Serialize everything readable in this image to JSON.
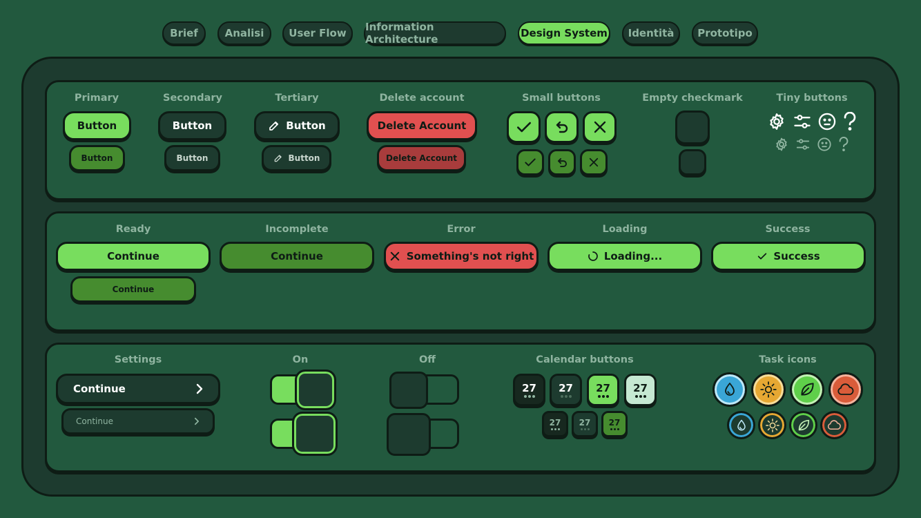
{
  "tabs": [
    {
      "label": "Brief",
      "active": false
    },
    {
      "label": "Analisi",
      "active": false
    },
    {
      "label": "User Flow",
      "active": false
    },
    {
      "label": "Information Architecture",
      "active": false
    },
    {
      "label": "Design System",
      "active": true
    },
    {
      "label": "Identità",
      "active": false
    },
    {
      "label": "Prototipo",
      "active": false
    }
  ],
  "buttons_panel": {
    "primary": {
      "label": "Primary",
      "large": "Button",
      "small": "Button"
    },
    "secondary": {
      "label": "Secondary",
      "large": "Button",
      "small": "Button"
    },
    "tertiary": {
      "label": "Tertiary",
      "large": "Button",
      "small": "Button",
      "icon": "pencil-icon"
    },
    "delete": {
      "label": "Delete account",
      "large": "Delete Account",
      "small": "Delete Account"
    },
    "small_buttons": {
      "label": "Small buttons",
      "icons": [
        "check-icon",
        "undo-icon",
        "close-icon"
      ]
    },
    "empty_checkmark": {
      "label": "Empty checkmark"
    },
    "tiny_buttons": {
      "label": "Tiny buttons",
      "icons": [
        "gear-icon",
        "sliders-icon",
        "face-icon",
        "question-icon"
      ]
    }
  },
  "states_panel": {
    "ready": {
      "label": "Ready",
      "large": "Continue",
      "small": "Continue"
    },
    "incomplete": {
      "label": "Incomplete",
      "large": "Continue"
    },
    "error": {
      "label": "Error",
      "large": "Something's not right",
      "icon": "close-icon"
    },
    "loading": {
      "label": "Loading",
      "large": "Loading...",
      "icon": "spinner-icon"
    },
    "success": {
      "label": "Success",
      "large": "Success",
      "icon": "check-icon"
    }
  },
  "misc_panel": {
    "settings": {
      "label": "Settings",
      "large": "Continue",
      "small": "Continue",
      "icon": "chevron-right-icon"
    },
    "on": {
      "label": "On"
    },
    "off": {
      "label": "Off"
    },
    "calendar": {
      "label": "Calendar buttons",
      "day": "27"
    },
    "task_icons": {
      "label": "Task icons",
      "icons": [
        "water-drop-icon",
        "sun-icon",
        "leaf-icon",
        "cloud-icon"
      ]
    }
  },
  "colors": {
    "background": "#22593e",
    "frame": "#1d3b2f",
    "outline": "#0e1c15",
    "green": "#78dd5e",
    "dark_green": "#468c2f",
    "red": "#e15050",
    "dark_red": "#a83c3c",
    "label": "#8fb4a0",
    "blue": "#3aa6d6",
    "yellow": "#e6a833",
    "orange": "#d95c3a"
  }
}
